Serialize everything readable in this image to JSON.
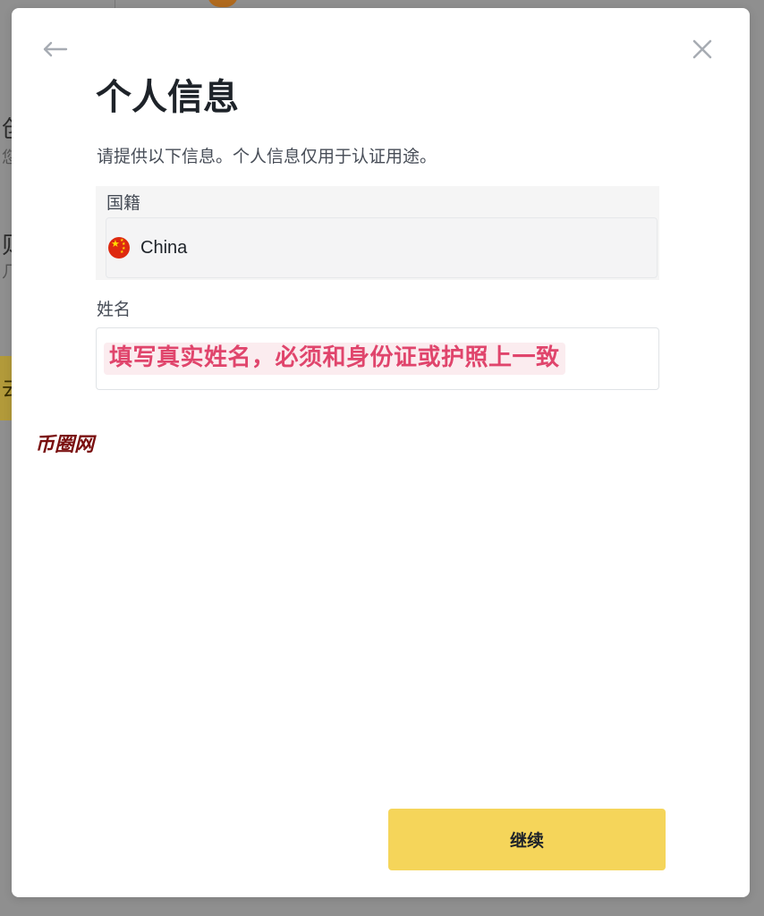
{
  "background": {
    "partial_texts": [
      "创",
      "您",
      "则",
      "几",
      "去"
    ]
  },
  "modal": {
    "title": "个人信息",
    "subtitle": "请提供以下信息。个人信息仅用于认证用途。",
    "nationality": {
      "label": "国籍",
      "value": "China",
      "flag_icon": "china-flag-icon"
    },
    "name": {
      "label": "姓名",
      "hint": "填写真实姓名，必须和身份证或护照上一致"
    },
    "watermark": "币圈网",
    "continue_label": "继续",
    "icons": {
      "back": "arrow-left-icon",
      "close": "close-icon"
    }
  },
  "colors": {
    "accent_button": "#f5d55a",
    "hint_text": "#e0456c",
    "hint_background": "#fbecef",
    "watermark": "#7a1010"
  }
}
